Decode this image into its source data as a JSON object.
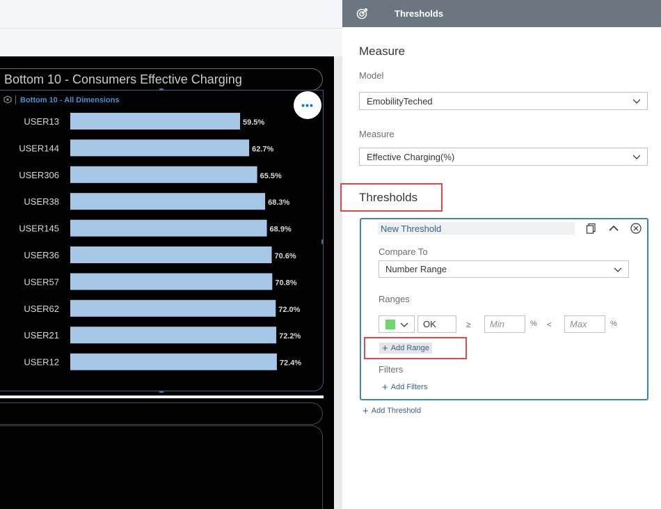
{
  "canvas": {
    "story_title": "Bottom 10 - Consumers Effective Charging",
    "chart_subtitle": "Bottom 10 - All Dimensions",
    "more_button": "•••"
  },
  "chart_data": {
    "type": "bar",
    "orientation": "horizontal",
    "title": "Bottom 10 - Consumers Effective Charging",
    "subtitle": "Bottom 10 - All Dimensions",
    "categories": [
      "USER13",
      "USER144",
      "USER306",
      "USER38",
      "USER145",
      "USER36",
      "USER57",
      "USER62",
      "USER21",
      "USER12"
    ],
    "values": [
      59.5,
      62.7,
      65.5,
      68.3,
      68.9,
      70.6,
      70.8,
      72.0,
      72.2,
      72.4
    ],
    "value_labels": [
      "59.5%",
      "62.7%",
      "65.5%",
      "68.3%",
      "68.9%",
      "70.6%",
      "70.8%",
      "72.0%",
      "72.2%",
      "72.4%"
    ],
    "unit": "%",
    "bar_color": "#a7c7e7",
    "grid": false
  },
  "panel": {
    "header_title": "Thresholds",
    "header_icon": "target-icon",
    "measure_section": "Measure",
    "model_label": "Model",
    "model_value": "EmobilityTeched",
    "measure_label": "Measure",
    "measure_value": "Effective Charging(%)",
    "thresholds_section": "Thresholds",
    "threshold": {
      "name": "New Threshold",
      "compare_to_label": "Compare To",
      "compare_to_value": "Number Range",
      "ranges_label": "Ranges",
      "range": {
        "color": "#6fd66f",
        "name": "OK",
        "gte": "≥",
        "min_placeholder": "Min",
        "unit1": "%",
        "lt": "<",
        "max_placeholder": "Max",
        "unit2": "%"
      },
      "add_range": "Add Range",
      "filters_label": "Filters",
      "add_filters": "Add Filters"
    },
    "add_threshold": "Add Threshold"
  },
  "colors": {
    "header_bg": "#6a7780",
    "card_border": "#3e82c4",
    "highlight": "#e0474f",
    "link": "#346187"
  }
}
